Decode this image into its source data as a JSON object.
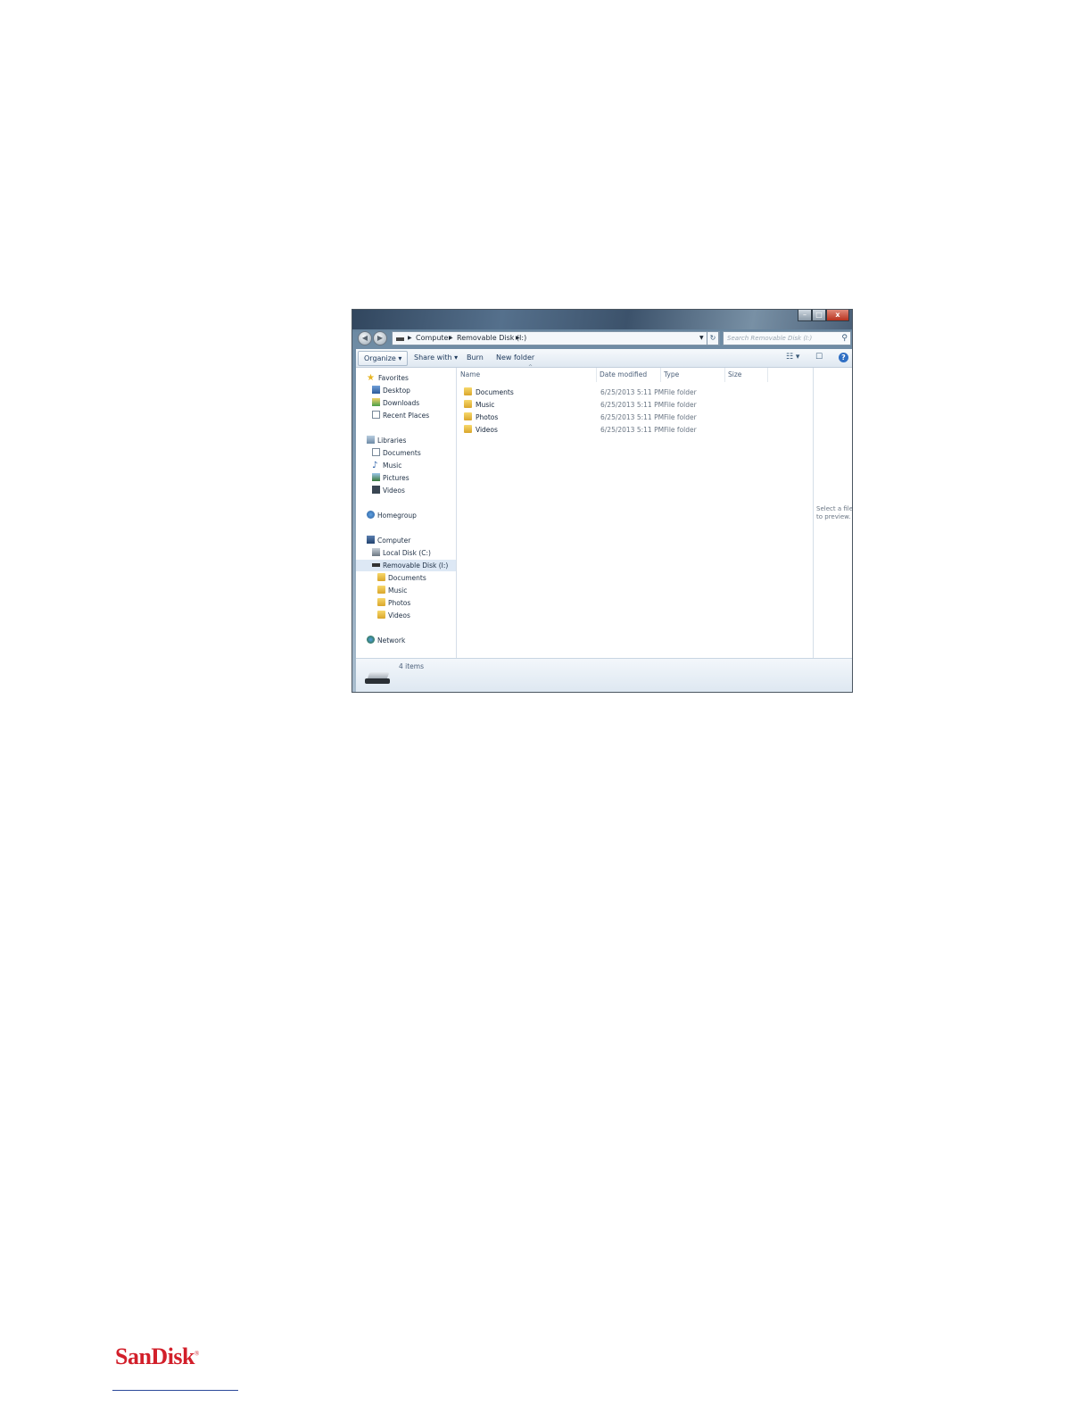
{
  "window": {
    "caption_buttons": [
      "–",
      "□",
      "x"
    ],
    "breadcrumbs": [
      "Computer",
      "Removable Disk (I:)"
    ],
    "search_placeholder": "Search Removable Disk (I:)",
    "toolbar": {
      "organize": "Organize ▾",
      "share_with": "Share with ▾",
      "burn": "Burn",
      "new_folder": "New folder"
    },
    "nav": {
      "favorites": "Favorites",
      "desktop": "Desktop",
      "downloads": "Downloads",
      "recent_places": "Recent Places",
      "libraries": "Libraries",
      "lib_documents": "Documents",
      "lib_music": "Music",
      "lib_pictures": "Pictures",
      "lib_videos": "Videos",
      "homegroup": "Homegroup",
      "computer": "Computer",
      "local_disk": "Local Disk (C:)",
      "removable_disk": "Removable Disk (I:)",
      "rd_documents": "Documents",
      "rd_music": "Music",
      "rd_photos": "Photos",
      "rd_videos": "Videos",
      "network": "Network"
    },
    "columns": {
      "name": "Name",
      "date": "Date modified",
      "type": "Type",
      "size": "Size"
    },
    "files": [
      {
        "name": "Documents",
        "date": "6/25/2013 5:11 PM",
        "type": "File folder"
      },
      {
        "name": "Music",
        "date": "6/25/2013 5:11 PM",
        "type": "File folder"
      },
      {
        "name": "Photos",
        "date": "6/25/2013 5:11 PM",
        "type": "File folder"
      },
      {
        "name": "Videos",
        "date": "6/25/2013 5:11 PM",
        "type": "File folder"
      }
    ],
    "preview_text": "Select a file to preview.",
    "status_count": "4 items"
  },
  "footer": {
    "logo": "SanDisk",
    "logo_mark": "®",
    "brand_color": "#d21f2a"
  }
}
